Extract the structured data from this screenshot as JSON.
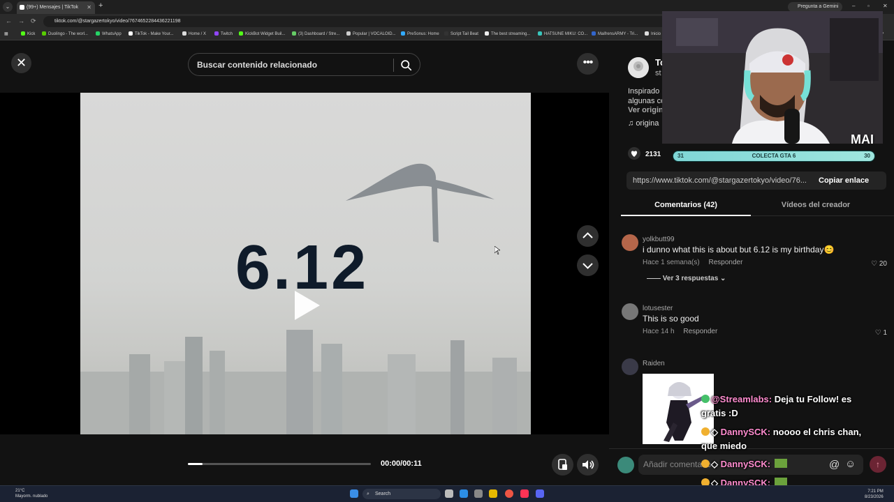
{
  "browser": {
    "tab_title": "(99+) Mensajes | TikTok",
    "url": "tiktok.com/@stargazertokyo/video/7674652284436221198",
    "gemini_label": "Pregunta a Gemini",
    "bookmarks": [
      "Kick",
      "Duolingo - The worl...",
      "WhatsApp",
      "TikTok - Make Your...",
      "Home / X",
      "Twitch",
      "KickBot Widget Buil...",
      "(3) Dashboard / Stre...",
      "Popular | VOCALOID...",
      "PreSonus: Home",
      "Script Tail Beat",
      "The best streaming...",
      "HATSUNE MIKU: CO...",
      "MaifrensARMY - Tri...",
      "Inicio"
    ]
  },
  "player": {
    "search_placeholder": "Buscar contenido relacionado",
    "frame_text": "6.12",
    "time": "00:00/00:11",
    "progress_fraction": 0.08
  },
  "post": {
    "creator_name": "To",
    "creator_handle": "st",
    "description_line1": "Inspirado p",
    "description_line2": "algunas co",
    "see_more": "Ver origin",
    "music": "origina",
    "likes": "2131",
    "share_url": "https://www.tiktok.com/@stargazertokyo/video/76...",
    "copy_label": "Copiar enlace"
  },
  "tabs": {
    "comments": "Comentarios (42)",
    "creator_videos": "Vídeos del creador"
  },
  "comments": [
    {
      "user": "yolkbutt99",
      "text": "i dunno what this is about but 6.12 is my birthday😊",
      "time": "Hace 1 semana(s)",
      "reply": "Responder",
      "likes": "20",
      "replies": "Ver 3 respuestas"
    },
    {
      "user": "lotusester",
      "text": "This is so good",
      "time": "Hace 14 h",
      "reply": "Responder",
      "likes": "1"
    },
    {
      "user": "Raiden",
      "text": "",
      "time": "",
      "reply": "",
      "likes": ""
    }
  ],
  "add_comment": {
    "placeholder": "Añadir comentario..."
  },
  "stream": {
    "goal_left": "31",
    "goal_label": "COLECTA GTA 6",
    "goal_right": "30",
    "cam_label": "MAI",
    "chat": [
      {
        "user": "@Streamlabs:",
        "text": " Deja tu Follow! es",
        "text2": "gratis :D"
      },
      {
        "user": "DannySCK:",
        "text": " noooo el chris chan,",
        "text2": "que miedo"
      },
      {
        "user": "DannySCK:",
        "text": ""
      },
      {
        "user": "DannySCK:",
        "text": ""
      }
    ]
  },
  "taskbar": {
    "temp": "21°C",
    "weather": "Mayorm. nublado",
    "search": "Search",
    "time": "7:21 PM",
    "date": "8/23/2026"
  }
}
